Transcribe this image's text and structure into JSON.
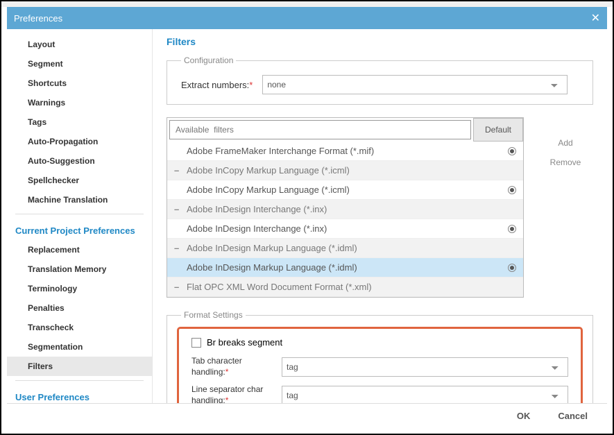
{
  "dialog": {
    "title": "Preferences"
  },
  "sidebar": {
    "general_items": [
      "Layout",
      "Segment",
      "Shortcuts",
      "Warnings",
      "Tags",
      "Auto-Propagation",
      "Auto-Suggestion",
      "Spellchecker",
      "Machine Translation"
    ],
    "project_section": "Current Project Preferences",
    "project_items": [
      "Replacement",
      "Translation Memory",
      "Terminology",
      "Penalties",
      "Transcheck",
      "Segmentation",
      "Filters"
    ],
    "selected": "Filters",
    "user_section": "User Preferences"
  },
  "content": {
    "title": "Filters",
    "config": {
      "legend": "Configuration",
      "extract_label": "Extract numbers:",
      "extract_value": "none"
    },
    "search_placeholder": "Available  filters",
    "default_btn": "Default",
    "add_label": "Add",
    "remove_label": "Remove",
    "filters": [
      {
        "label": "Adobe FrameMaker Interchange Format (*.mif)",
        "alt": false,
        "expand": false,
        "radio": true
      },
      {
        "label": "Adobe InCopy Markup Language (*.icml)",
        "alt": true,
        "expand": true,
        "radio": false
      },
      {
        "label": "Adobe InCopy Markup Language (*.icml)",
        "alt": false,
        "expand": false,
        "radio": true
      },
      {
        "label": "Adobe InDesign Interchange (*.inx)",
        "alt": true,
        "expand": true,
        "radio": false
      },
      {
        "label": "Adobe InDesign Interchange (*.inx)",
        "alt": false,
        "expand": false,
        "radio": true
      },
      {
        "label": "Adobe InDesign Markup Language (*.idml)",
        "alt": true,
        "expand": true,
        "radio": false
      },
      {
        "label": "Adobe InDesign Markup Language (*.idml)",
        "alt": false,
        "expand": false,
        "radio": true,
        "selected": true
      },
      {
        "label": "Flat OPC XML Word Document Format (*.xml)",
        "alt": true,
        "expand": true,
        "radio": false
      }
    ],
    "format": {
      "legend": "Format Settings",
      "br_label": "Br breaks segment",
      "tab_label": "Tab character handling:",
      "tab_value": "tag",
      "line_label": "Line separator char handling:",
      "line_value": "tag"
    }
  },
  "footer": {
    "ok": "OK",
    "cancel": "Cancel"
  }
}
